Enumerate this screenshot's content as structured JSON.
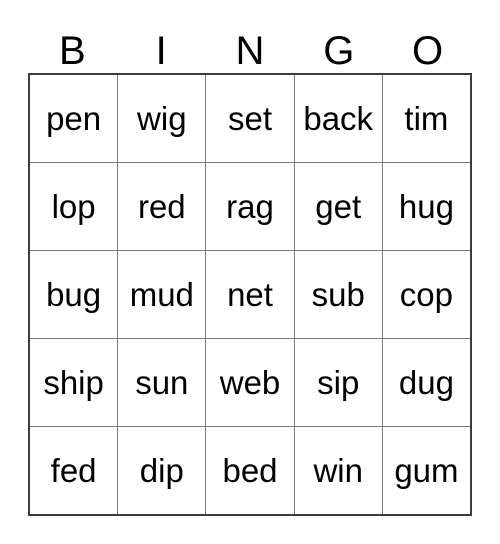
{
  "card": {
    "title": "BINGO",
    "header_letters": [
      "B",
      "I",
      "N",
      "G",
      "O"
    ],
    "grid": {
      "columns": 5,
      "rows": 5,
      "border_color": "#3b3b3b",
      "line_color": "#7a7a7a",
      "text_color": "#000000",
      "background_color": "#ffffff",
      "cells": [
        [
          "pen",
          "wig",
          "set",
          "back",
          "tim"
        ],
        [
          "lop",
          "red",
          "rag",
          "get",
          "hug"
        ],
        [
          "bug",
          "mud",
          "net",
          "sub",
          "cop"
        ],
        [
          "ship",
          "sun",
          "web",
          "sip",
          "dug"
        ],
        [
          "fed",
          "dip",
          "bed",
          "win",
          "gum"
        ]
      ]
    }
  }
}
